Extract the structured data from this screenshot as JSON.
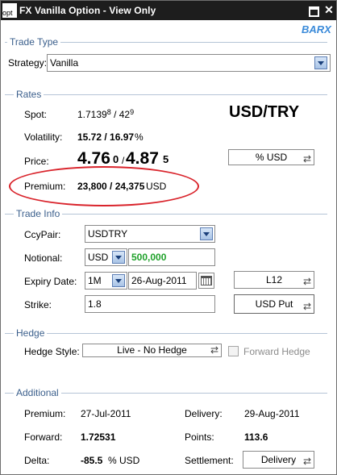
{
  "window": {
    "icon_text": "opt",
    "title": "FX Vanilla Option - View Only",
    "maximize": "□",
    "close": "✕",
    "brand": "BARX"
  },
  "trade_type": {
    "section": "Trade Type",
    "strategy_label": "Strategy:",
    "strategy_value": "Vanilla"
  },
  "rates": {
    "section": "Rates",
    "spot_label": "Spot:",
    "spot_bid_main": "1.7139",
    "spot_bid_pip": "8",
    "spot_sep": "/",
    "spot_ask_main": "42",
    "spot_ask_pip": "9",
    "pair": "USD/TRY",
    "vol_label": "Volatility:",
    "vol_value": "15.72 / 16.97",
    "vol_unit": "%",
    "price_label": "Price:",
    "price_bid": "4.76",
    "price_bid_small": "0",
    "price_sep": "/",
    "price_ask": "4.87",
    "price_ask_small": "5",
    "price_unit_btn": "% USD",
    "premium_label": "Premium:",
    "premium_value": "23,800 / 24,375",
    "premium_ccy": "USD"
  },
  "trade_info": {
    "section": "Trade Info",
    "ccypair_label": "CcyPair:",
    "ccypair_value": "USDTRY",
    "notional_label": "Notional:",
    "notional_ccy": "USD",
    "notional_value": "500,000",
    "expiry_label": "Expiry Date:",
    "expiry_tenor": "1M",
    "expiry_date": "26-Aug-2011",
    "cut_btn": "L12",
    "strike_label": "Strike:",
    "strike_value": "1.8",
    "put_call_btn": "USD Put"
  },
  "hedge": {
    "section": "Hedge",
    "style_label": "Hedge Style:",
    "style_value": "Live - No Hedge",
    "forward_hedge_label": "Forward Hedge"
  },
  "additional": {
    "section": "Additional",
    "premium_label": "Premium:",
    "premium_date": "27-Jul-2011",
    "delivery_label": "Delivery:",
    "delivery_date": "29-Aug-2011",
    "forward_label": "Forward:",
    "forward_value": "1.72531",
    "points_label": "Points:",
    "points_value": "113.6",
    "delta_label": "Delta:",
    "delta_value": "-85.5",
    "delta_unit": "% USD",
    "settlement_label": "Settlement:",
    "settlement_value": "Delivery"
  },
  "colors": {
    "title_bar": "#1d1d1d",
    "section_title": "#3b5f8c",
    "brand": "#3a8ad9",
    "notional_value": "#1fa12a",
    "annotation": "#d9232b"
  },
  "icons": {
    "swap": "swap-arrows-icon",
    "dropdown": "chevron-down-icon",
    "calendar": "calendar-icon"
  }
}
